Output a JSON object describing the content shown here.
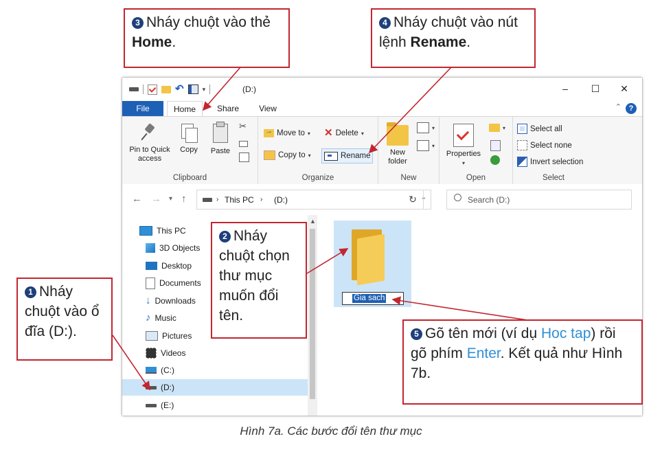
{
  "window": {
    "title": "(D:)",
    "minimize": "–",
    "maximize": "☐",
    "close": "✕"
  },
  "tabs": {
    "file": "File",
    "home": "Home",
    "share": "Share",
    "view": "View",
    "help": "?"
  },
  "ribbon": {
    "clipboard": {
      "label": "Clipboard",
      "pin": "Pin to Quick access",
      "copy": "Copy",
      "paste": "Paste"
    },
    "organize": {
      "label": "Organize",
      "move_to": "Move to",
      "copy_to": "Copy to",
      "delete": "Delete",
      "rename": "Rename"
    },
    "new": {
      "label": "New",
      "new_folder": "New folder"
    },
    "open": {
      "label": "Open",
      "properties": "Properties"
    },
    "select": {
      "label": "Select",
      "select_all": "Select all",
      "select_none": "Select none",
      "invert_selection": "Invert selection"
    }
  },
  "address": {
    "crumb_1": "This PC",
    "crumb_2": "(D:)",
    "search_placeholder": "Search (D:)"
  },
  "nav_pane": {
    "this_pc": "This PC",
    "objects_3d": "3D Objects",
    "desktop": "Desktop",
    "documents": "Documents",
    "downloads": "Downloads",
    "music": "Music",
    "pictures": "Pictures",
    "videos": "Videos",
    "drive_c": "(C:)",
    "drive_d": "(D:)",
    "drive_e": "(E:)"
  },
  "content": {
    "folder_name": "Gia sach"
  },
  "callouts": {
    "c1": {
      "num": "1",
      "text": "Nháy chuột vào ổ đĩa (D:)."
    },
    "c2": {
      "num": "2",
      "text": "Nháy chuột chọn thư mục muốn đổi tên."
    },
    "c3": {
      "num": "3",
      "text_a": "Nháy chuột vào thẻ ",
      "bold": "Home",
      "text_b": "."
    },
    "c4": {
      "num": "4",
      "text_a": "Nháy chuột vào nút lệnh ",
      "bold": "Rename",
      "text_b": "."
    },
    "c5": {
      "num": "5",
      "text_a": "Gõ tên mới (ví dụ ",
      "hl1": "Hoc tap",
      "text_b": ") rồi gõ phím ",
      "hl2": "Enter",
      "text_c": ". Kết quả như Hình 7b."
    }
  },
  "caption": "Hình 7a. Các bước đổi tên thư mục",
  "colors": {
    "callout_border": "#c22630",
    "accent_blue": "#1e60b6",
    "selection": "#cce4f7",
    "highlight_text": "#2f8fd6"
  }
}
